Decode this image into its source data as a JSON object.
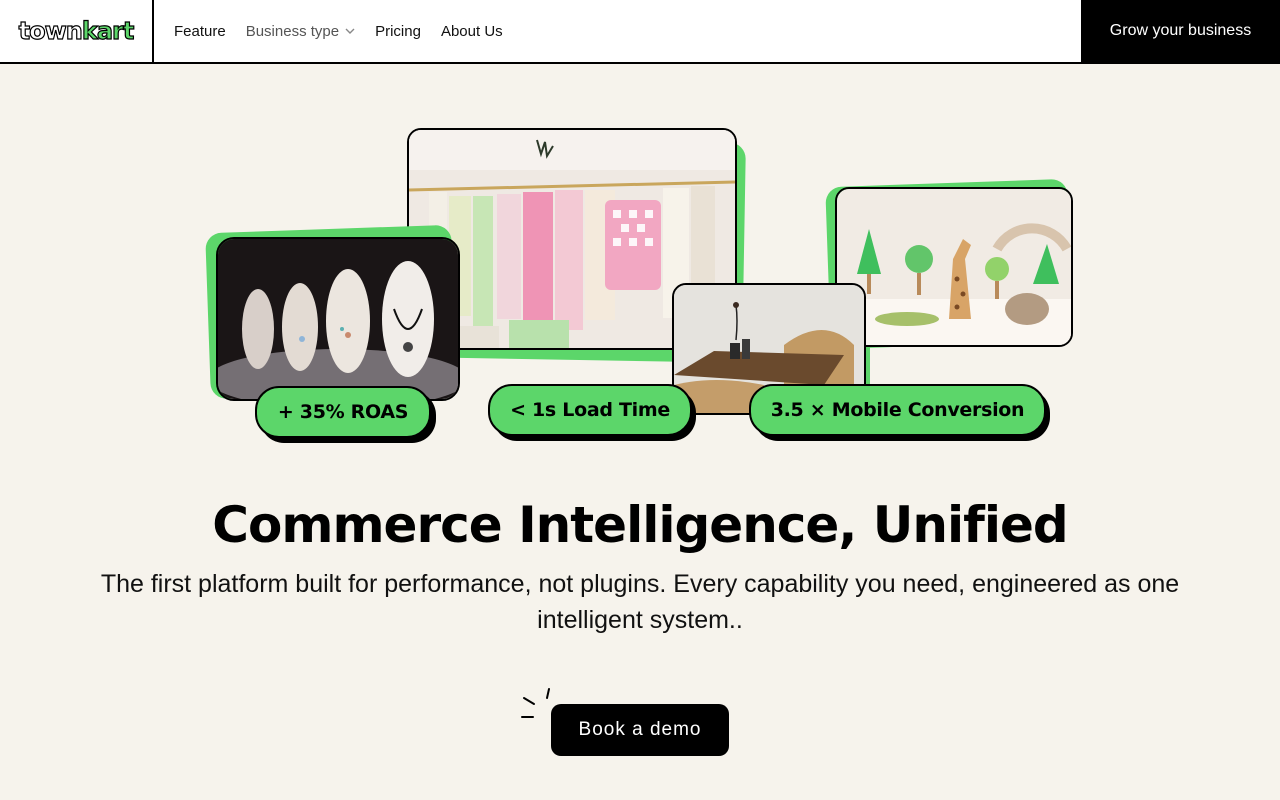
{
  "nav": {
    "logo_part1": "town",
    "logo_part2": "kart",
    "links": [
      "Feature",
      "Business type",
      "Pricing",
      "About Us"
    ],
    "cta": "Grow your business"
  },
  "stats": {
    "roas": "+ 35% ROAS",
    "load": "< 1s Load Time",
    "mobile": "3.5 × Mobile Conversion"
  },
  "hero": {
    "headline": "Commerce Intelligence, Unified",
    "subhead": "The first platform built for performance, not plugins. Every capability you need, engineered as one intelligent system..",
    "button": "Book a demo"
  },
  "colors": {
    "accent": "#5cd66a",
    "background": "#f6f3ec",
    "dark": "#000000"
  }
}
